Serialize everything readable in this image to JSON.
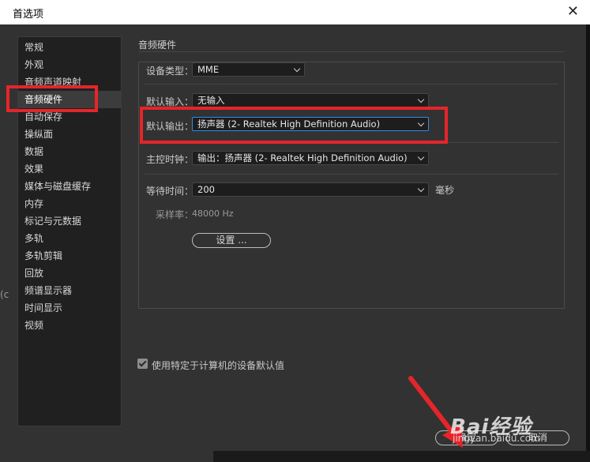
{
  "window": {
    "title": "首选项",
    "close_glyph": "✕"
  },
  "sidebar": {
    "items": [
      {
        "label": "常规"
      },
      {
        "label": "外观"
      },
      {
        "label": "音频声道映射"
      },
      {
        "label": "音频硬件",
        "selected": true
      },
      {
        "label": "自动保存"
      },
      {
        "label": "操纵面"
      },
      {
        "label": "数据"
      },
      {
        "label": "效果"
      },
      {
        "label": "媒体与磁盘缓存"
      },
      {
        "label": "内存"
      },
      {
        "label": "标记与元数据"
      },
      {
        "label": "多轨"
      },
      {
        "label": "多轨剪辑"
      },
      {
        "label": "回放"
      },
      {
        "label": "频谱显示器"
      },
      {
        "label": "时间显示"
      },
      {
        "label": "视频"
      }
    ]
  },
  "panel": {
    "title": "音频硬件",
    "device_type": {
      "label": "设备类型：",
      "value": "MME"
    },
    "default_input": {
      "label": "默认输入：",
      "value": "无输入"
    },
    "default_output": {
      "label": "默认输出：",
      "value": "扬声器 (2- Realtek High Definition Audio)"
    },
    "master_clock": {
      "label": "主控时钟：",
      "value": "输出：扬声器 (2- Realtek High Definition Audio)"
    },
    "latency": {
      "label": "等待时间：",
      "value": "200",
      "unit": "毫秒"
    },
    "sample_rate": {
      "label": "采样率：",
      "value": "48000 Hz"
    },
    "settings_button": "设置 ...",
    "use_device_defaults": {
      "label": "使用特定于计算机的设备默认值",
      "checked": true
    }
  },
  "footer": {
    "ok_label": "确定",
    "cancel_label": "取消"
  },
  "watermark": {
    "text": "Bai经验",
    "url": "jingyan.baidu.com"
  },
  "bleed_left_text": "(c",
  "colors": {
    "highlight": "#e5252a",
    "focus": "#2d8ceb",
    "panel_bg": "#323232"
  }
}
